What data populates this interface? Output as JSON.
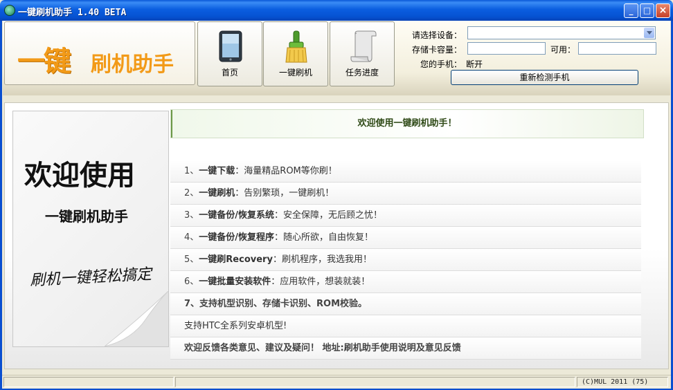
{
  "window": {
    "title": "一键刷机助手 1.40 BETA",
    "minimize": "_",
    "maximize": "□",
    "close": "×"
  },
  "logo": {
    "big": "一键",
    "small": "刷机助手"
  },
  "nav": [
    {
      "label": "首页",
      "icon": "tablet-icon"
    },
    {
      "label": "一键刷机",
      "icon": "brush-icon"
    },
    {
      "label": "任务进度",
      "icon": "scroll-icon"
    }
  ],
  "device": {
    "select_label": "请选择设备：",
    "select_value": "",
    "storage_label": "存储卡容量：",
    "storage_value": "",
    "available_label": "可用：",
    "available_value": "",
    "phone_label": "您的手机：",
    "phone_status": "断开",
    "redetect_label": "重新检测手机"
  },
  "left_panel": {
    "line1": "欢迎使用",
    "line2": "一键刷机助手",
    "line3": "刷机一键轻松搞定"
  },
  "welcome": "欢迎使用一键刷机助手！",
  "features": [
    {
      "num": "1、",
      "key": "一键下载",
      "desc": "：海量精品ROM等你刷！"
    },
    {
      "num": "2、",
      "key": "一键刷机",
      "desc": "：告别繁琐，一键刷机！"
    },
    {
      "num": "3、",
      "key": "一键备份/恢复系统",
      "desc": "：安全保障，无后顾之忧！"
    },
    {
      "num": "4、",
      "key": "一键备份/恢复程序",
      "desc": "：随心所欲，自由恢复！"
    },
    {
      "num": "5、",
      "key": "一键刷Recovery",
      "desc": "：刷机程序，我选我用！"
    },
    {
      "num": "6、",
      "key": "一键批量安装软件",
      "desc": "：应用软件，想装就装！"
    }
  ],
  "feature7": "7、支持机型识别、存储卡识别、ROM校验。",
  "htc_note": "支持HTC全系列安卓机型!",
  "feedback": "欢迎反馈各类意见、建议及疑问！ 地址:刷机助手使用说明及意见反馈",
  "status": {
    "copyright": "(C)MUL 2011  (75)"
  },
  "colors": {
    "titlebar": "#0b5ee0",
    "logo_orange": "#f29a18",
    "welcome_green": "#2f4a17"
  }
}
